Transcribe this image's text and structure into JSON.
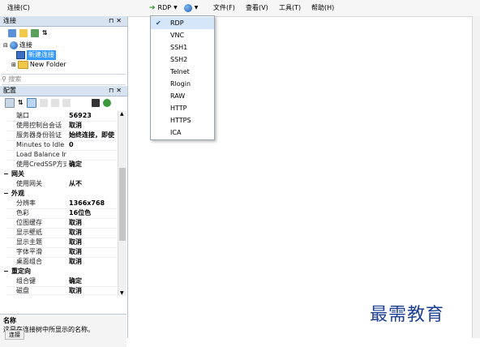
{
  "toolbar": {
    "connection_menu": "连接(C)",
    "protocol_current": "RDP",
    "menus": [
      "文件(F)",
      "查看(V)",
      "工具(T)",
      "帮助(H)"
    ]
  },
  "connections_pane": {
    "title": "连接",
    "tree": {
      "root": "连接",
      "selected_item": "新建连接",
      "folder": "New Folder"
    },
    "search_placeholder": "搜索"
  },
  "config_pane": {
    "title": "配置",
    "rows": [
      {
        "key": "端口",
        "value": "56923"
      },
      {
        "key": "使用控制台会话",
        "value": "取消"
      },
      {
        "key": "服务器身份验证",
        "value": "始终连接，即使"
      },
      {
        "key": "Minutes to Idle",
        "value": "0"
      },
      {
        "key": "Load Balance Info",
        "value": ""
      },
      {
        "key": "使用CredSSP方式",
        "value": "确定"
      }
    ],
    "category_gateway": "网关",
    "gateway_rows": [
      {
        "key": "使用网关",
        "value": "从不"
      }
    ],
    "category_appearance": "外观",
    "appearance_rows": [
      {
        "key": "分辨率",
        "value": "1366x768"
      },
      {
        "key": "色彩",
        "value": "16位色"
      },
      {
        "key": "位图缓存",
        "value": "取消"
      },
      {
        "key": "显示壁纸",
        "value": "取消"
      },
      {
        "key": "显示主题",
        "value": "取消"
      },
      {
        "key": "字体平滑",
        "value": "取消"
      },
      {
        "key": "桌面组合",
        "value": "取消"
      }
    ],
    "category_redirect": "重定向",
    "redirect_rows": [
      {
        "key": "组合键",
        "value": "确定"
      },
      {
        "key": "磁盘",
        "value": "取消"
      }
    ],
    "description_title": "名称",
    "description_text": "这是在连接树中所显示的名称。"
  },
  "protocol_dropdown": {
    "options": [
      "RDP",
      "VNC",
      "SSH1",
      "SSH2",
      "Telnet",
      "Rlogin",
      "RAW",
      "HTTP",
      "HTTPS",
      "ICA"
    ],
    "checked_index": 0
  },
  "bottom_tab": "连接",
  "watermark": "最需教育",
  "colors": {
    "pane_title_bg": "#d7e3f1",
    "selection": "#3399ff",
    "checked_item_bg": "#d5e6f8",
    "watermark": "#1d3f93"
  }
}
